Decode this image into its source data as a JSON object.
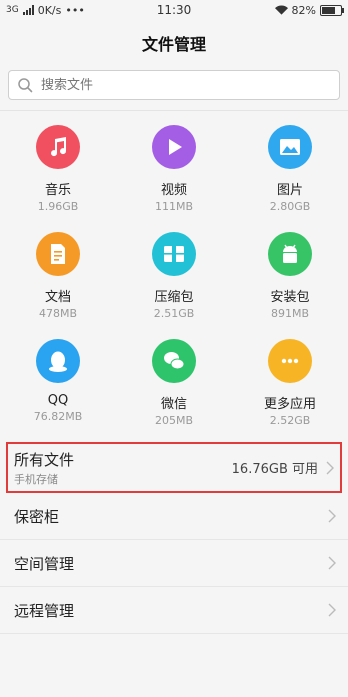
{
  "status": {
    "network": "3G",
    "speed": "0K/s",
    "more": "•••",
    "time": "11:30",
    "battery": "82%",
    "battery_level": 0.82
  },
  "header": {
    "title": "文件管理"
  },
  "search": {
    "placeholder": "搜索文件"
  },
  "categories": [
    {
      "name": "音乐",
      "size": "1.96GB",
      "icon": "music-icon",
      "color": "#f0505f"
    },
    {
      "name": "视频",
      "size": "111MB",
      "icon": "play-icon",
      "color": "#a45ee5"
    },
    {
      "name": "图片",
      "size": "2.80GB",
      "icon": "image-icon",
      "color": "#2fa8f0"
    },
    {
      "name": "文档",
      "size": "478MB",
      "icon": "document-icon",
      "color": "#f59a26"
    },
    {
      "name": "压缩包",
      "size": "2.51GB",
      "icon": "archive-icon",
      "color": "#22c1d6"
    },
    {
      "name": "安装包",
      "size": "891MB",
      "icon": "android-icon",
      "color": "#37c467"
    },
    {
      "name": "QQ",
      "size": "76.82MB",
      "icon": "qq-icon",
      "color": "#2aa3f0"
    },
    {
      "name": "微信",
      "size": "205MB",
      "icon": "wechat-icon",
      "color": "#2ec46b"
    },
    {
      "name": "更多应用",
      "size": "2.52GB",
      "icon": "more-icon",
      "color": "#f7b526"
    }
  ],
  "all_files": {
    "title": "所有文件",
    "subtitle": "手机存储",
    "available": "16.76GB 可用"
  },
  "menu": [
    {
      "label": "保密柜"
    },
    {
      "label": "空间管理"
    },
    {
      "label": "远程管理"
    }
  ]
}
